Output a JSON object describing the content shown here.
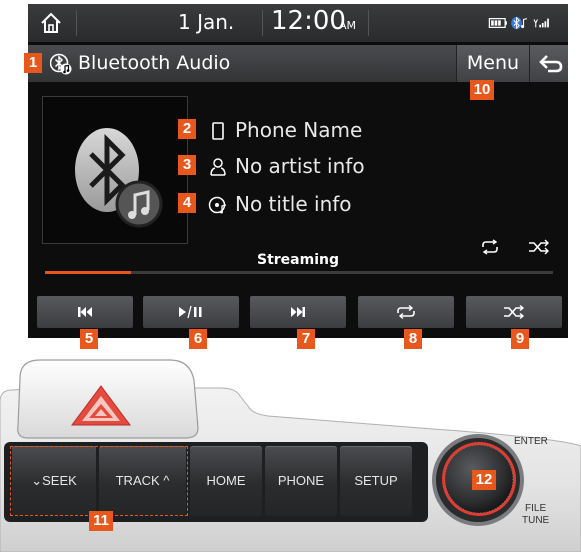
{
  "status_bar": {
    "date": "1 Jan.",
    "time": "12:00",
    "ampm": "AM",
    "icons": [
      "battery-icon",
      "bluetooth-audio-icon",
      "signal-icon"
    ]
  },
  "title_bar": {
    "title": "Bluetooth Audio",
    "menu_label": "Menu",
    "back_icon": "back-arrow-icon"
  },
  "track_info": {
    "phone_name": "Phone Name",
    "artist": "No artist info",
    "title": "No title info"
  },
  "playback": {
    "status_label": "Streaming",
    "progress": 0.17,
    "mode_icons": [
      "repeat-icon",
      "shuffle-icon"
    ],
    "controls": [
      "previous-icon",
      "play-pause-icon",
      "next-icon",
      "repeat-icon",
      "shuffle-icon"
    ]
  },
  "callouts": {
    "n1": "1",
    "n2": "2",
    "n3": "3",
    "n4": "4",
    "n5": "5",
    "n6": "6",
    "n7": "7",
    "n8": "8",
    "n9": "9",
    "n10": "10",
    "n11": "11",
    "n12": "12"
  },
  "hardware": {
    "seek_label": "SEEK",
    "track_label": "TRACK",
    "home_label": "HOME",
    "phone_label": "PHONE",
    "setup_label": "SETUP",
    "enter_label": "ENTER",
    "file_label": "FILE",
    "tune_label": "TUNE"
  },
  "colors": {
    "callout": "#e8581c",
    "progress": "#e8541e",
    "screen_bg": "#0d0d0e"
  }
}
